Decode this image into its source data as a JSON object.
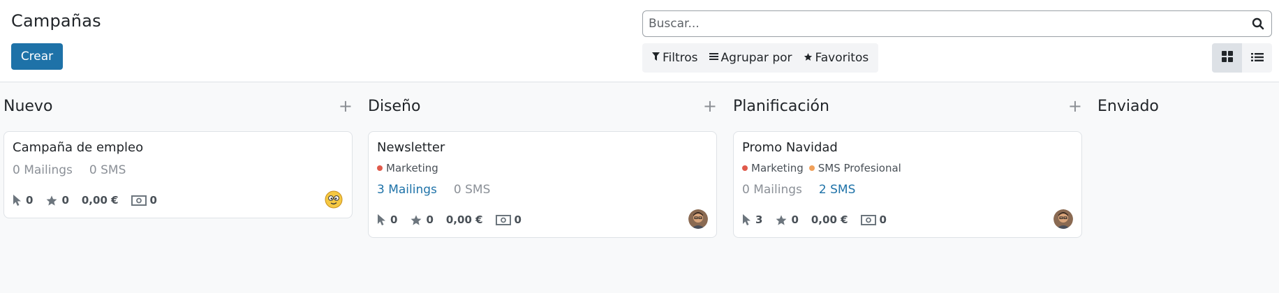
{
  "header": {
    "title": "Campañas",
    "create_label": "Crear",
    "search_placeholder": "Buscar...",
    "filters_label": "Filtros",
    "group_by_label": "Agrupar por",
    "favorites_label": "Favoritos"
  },
  "columns": [
    {
      "title": "Nuevo",
      "card": {
        "title": "Campaña de empleo",
        "tags": [],
        "mailings": "0 Mailings",
        "sms": "0 SMS",
        "clicks": "0",
        "stars": "0",
        "revenue": "0,00 €",
        "quotations": "0",
        "avatar": "smiley"
      }
    },
    {
      "title": "Diseño",
      "card": {
        "title": "Newsletter",
        "tags": [
          {
            "label": "Marketing",
            "color": "#e05a4b"
          }
        ],
        "mailings": "3 Mailings",
        "sms": "0 SMS",
        "clicks": "0",
        "stars": "0",
        "revenue": "0,00 €",
        "quotations": "0",
        "avatar": "user-photo"
      }
    },
    {
      "title": "Planificación",
      "card": {
        "title": "Promo Navidad",
        "tags": [
          {
            "label": "Marketing",
            "color": "#e05a4b"
          },
          {
            "label": "SMS Profesional",
            "color": "#f0a05a"
          }
        ],
        "mailings": "0 Mailings",
        "sms": "2 SMS",
        "clicks": "3",
        "stars": "0",
        "revenue": "0,00 €",
        "quotations": "0",
        "avatar": "user-photo"
      }
    },
    {
      "title": "Enviado"
    }
  ],
  "colors": {
    "primary": "#1e72a8",
    "link": "#1e72a8",
    "tag_marketing": "#e05a4b",
    "tag_sms": "#f0a05a"
  }
}
